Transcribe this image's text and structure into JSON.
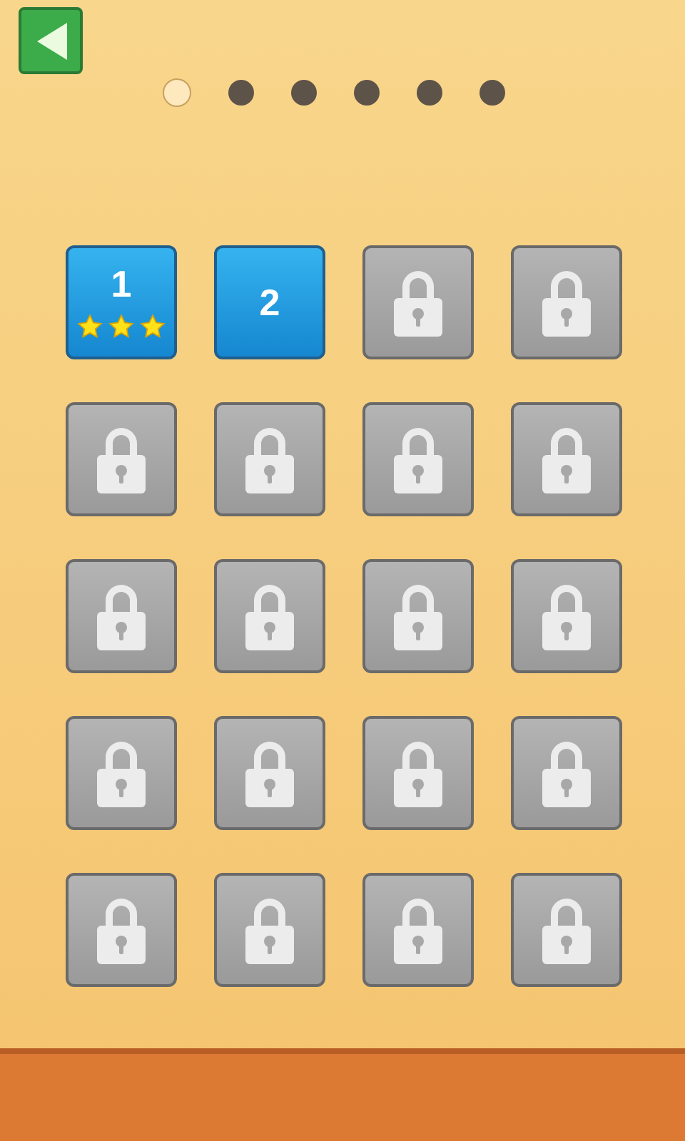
{
  "pages": [
    {
      "selected": true
    },
    {
      "selected": false
    },
    {
      "selected": false
    },
    {
      "selected": false
    },
    {
      "selected": false
    },
    {
      "selected": false
    }
  ],
  "levels": [
    {
      "kind": "unlocked",
      "label": "1",
      "stars": 3
    },
    {
      "kind": "unlocked",
      "label": "2"
    },
    {
      "kind": "locked"
    },
    {
      "kind": "locked"
    },
    {
      "kind": "locked"
    },
    {
      "kind": "locked"
    },
    {
      "kind": "locked"
    },
    {
      "kind": "locked"
    },
    {
      "kind": "locked"
    },
    {
      "kind": "locked"
    },
    {
      "kind": "locked"
    },
    {
      "kind": "locked"
    },
    {
      "kind": "locked"
    },
    {
      "kind": "locked"
    },
    {
      "kind": "locked"
    },
    {
      "kind": "locked"
    },
    {
      "kind": "locked"
    },
    {
      "kind": "locked"
    },
    {
      "kind": "locked"
    },
    {
      "kind": "locked"
    }
  ]
}
